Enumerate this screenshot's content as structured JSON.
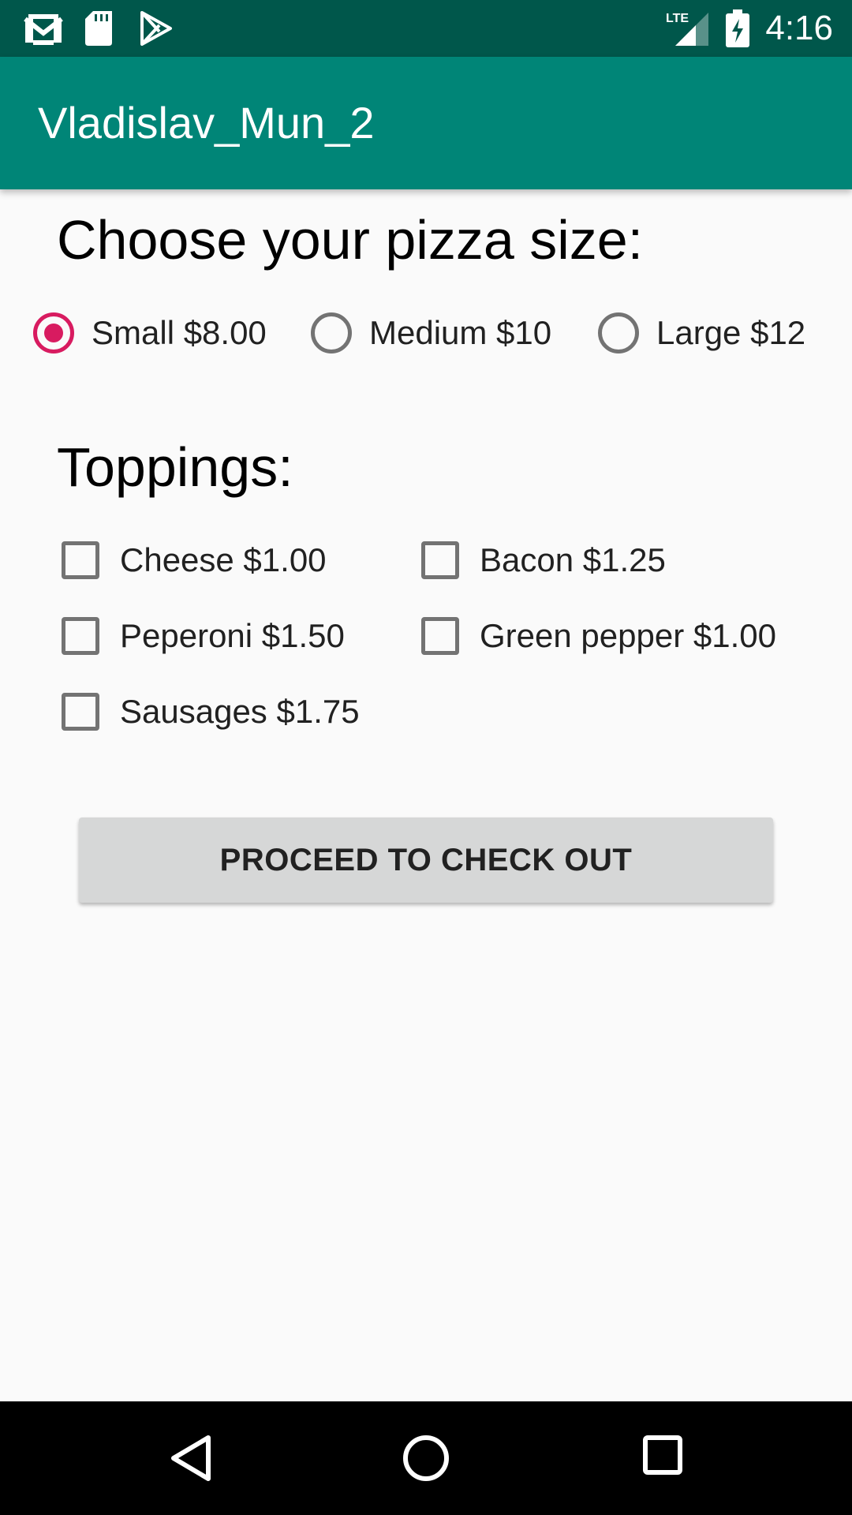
{
  "status_bar": {
    "time": "4:16",
    "network": "LTE",
    "icons": [
      "gmail-icon",
      "sd-card-icon",
      "play-store-icon",
      "lte-signal-icon",
      "battery-charging-icon"
    ]
  },
  "app_bar": {
    "title": "Vladislav_Mun_2"
  },
  "pizza_size": {
    "heading": "Choose your pizza size:",
    "options": [
      {
        "label": "Small $8.00",
        "checked": true
      },
      {
        "label": "Medium $10",
        "checked": false
      },
      {
        "label": "Large $12",
        "checked": false
      }
    ],
    "accent_color": "#d81b60"
  },
  "toppings": {
    "heading": "Toppings:",
    "items": [
      {
        "label": "Cheese $1.00",
        "checked": false
      },
      {
        "label": "Bacon $1.25",
        "checked": false
      },
      {
        "label": "Peperoni $1.50",
        "checked": false
      },
      {
        "label": "Green pepper $1.00",
        "checked": false
      },
      {
        "label": "Sausages $1.75",
        "checked": false
      }
    ]
  },
  "checkout_button": {
    "label": "PROCEED TO CHECK OUT"
  },
  "nav_bar": {
    "icons": [
      "back-icon",
      "home-icon",
      "recents-icon"
    ]
  },
  "colors": {
    "primary": "#008577",
    "primary_dark": "#00574b",
    "accent": "#d81b60"
  }
}
